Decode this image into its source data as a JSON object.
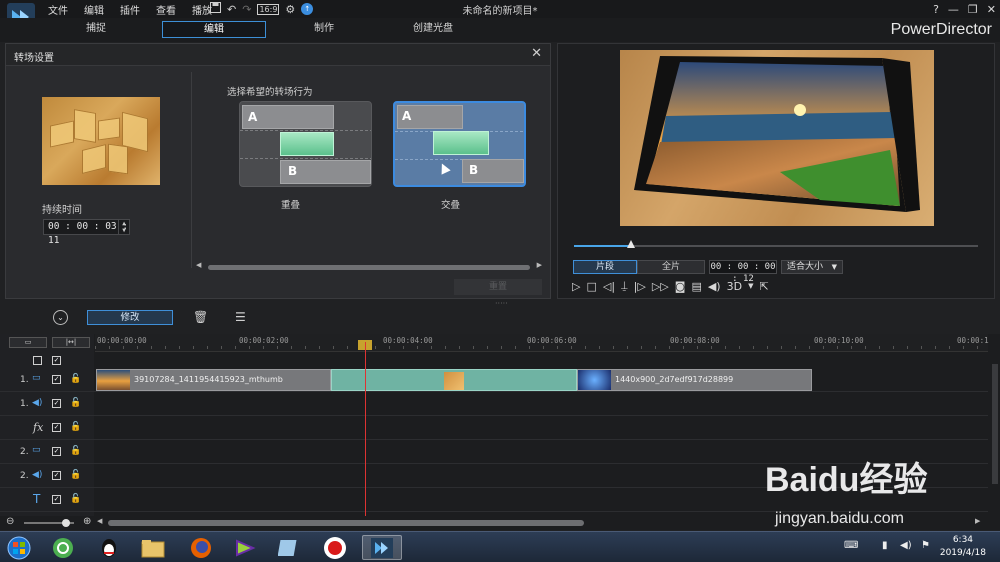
{
  "app": {
    "menus": [
      "文件",
      "编辑",
      "插件",
      "查看",
      "播放"
    ],
    "document_title": "未命名的新项目*",
    "brand": "PowerDirector"
  },
  "mode_tabs": [
    {
      "label": "捕捉",
      "active": false
    },
    {
      "label": "编辑",
      "active": true
    },
    {
      "label": "制作",
      "active": false
    },
    {
      "label": "创建光盘",
      "active": false
    }
  ],
  "transition_panel": {
    "title": "转场设置",
    "duration_label": "持续时间",
    "duration_value": "00 : 00 : 03 : 11",
    "behavior_label": "选择希望的转场行为",
    "options": [
      {
        "caption": "重叠",
        "a": "A",
        "b": "B",
        "selected": false
      },
      {
        "caption": "交叠",
        "a": "A",
        "b": "B",
        "selected": true
      }
    ],
    "reset_button": "重置"
  },
  "player": {
    "clip_button": "片段",
    "full_button": "全片",
    "timecode": "00 : 00 : 00 : 12",
    "fit_select": "适合大小",
    "three_d": "3D",
    "progress": 0.14
  },
  "toolbar": {
    "modify_button": "修改"
  },
  "timeline": {
    "ruler_ticks": [
      "00:00:00:00",
      "00:00:02:00",
      "00:00:04:00",
      "00:00:06:00",
      "00:00:08:00",
      "00:00:10:00",
      "00:00:1"
    ],
    "tracks": [
      {
        "num": "1.",
        "kind": "video"
      },
      {
        "num": "1.",
        "kind": "audio"
      },
      {
        "num": "",
        "kind": "fx",
        "glyph": "fx"
      },
      {
        "num": "2.",
        "kind": "video"
      },
      {
        "num": "2.",
        "kind": "audio"
      },
      {
        "num": "",
        "kind": "title",
        "glyph": "T"
      }
    ],
    "clips": [
      {
        "label": "39107284_1411954415923_mthumb"
      },
      {
        "label": "1440x900_2d7edf917d28899"
      }
    ]
  },
  "taskbar": {
    "time": "6:34",
    "date": "2019/4/18"
  },
  "watermark": {
    "brand": "Baidu经验",
    "url": "jingyan.baidu.com"
  },
  "colors": {
    "accent": "#3d8fd6",
    "transition_green": "#6ccf9a",
    "playhead": "#dd3333"
  }
}
